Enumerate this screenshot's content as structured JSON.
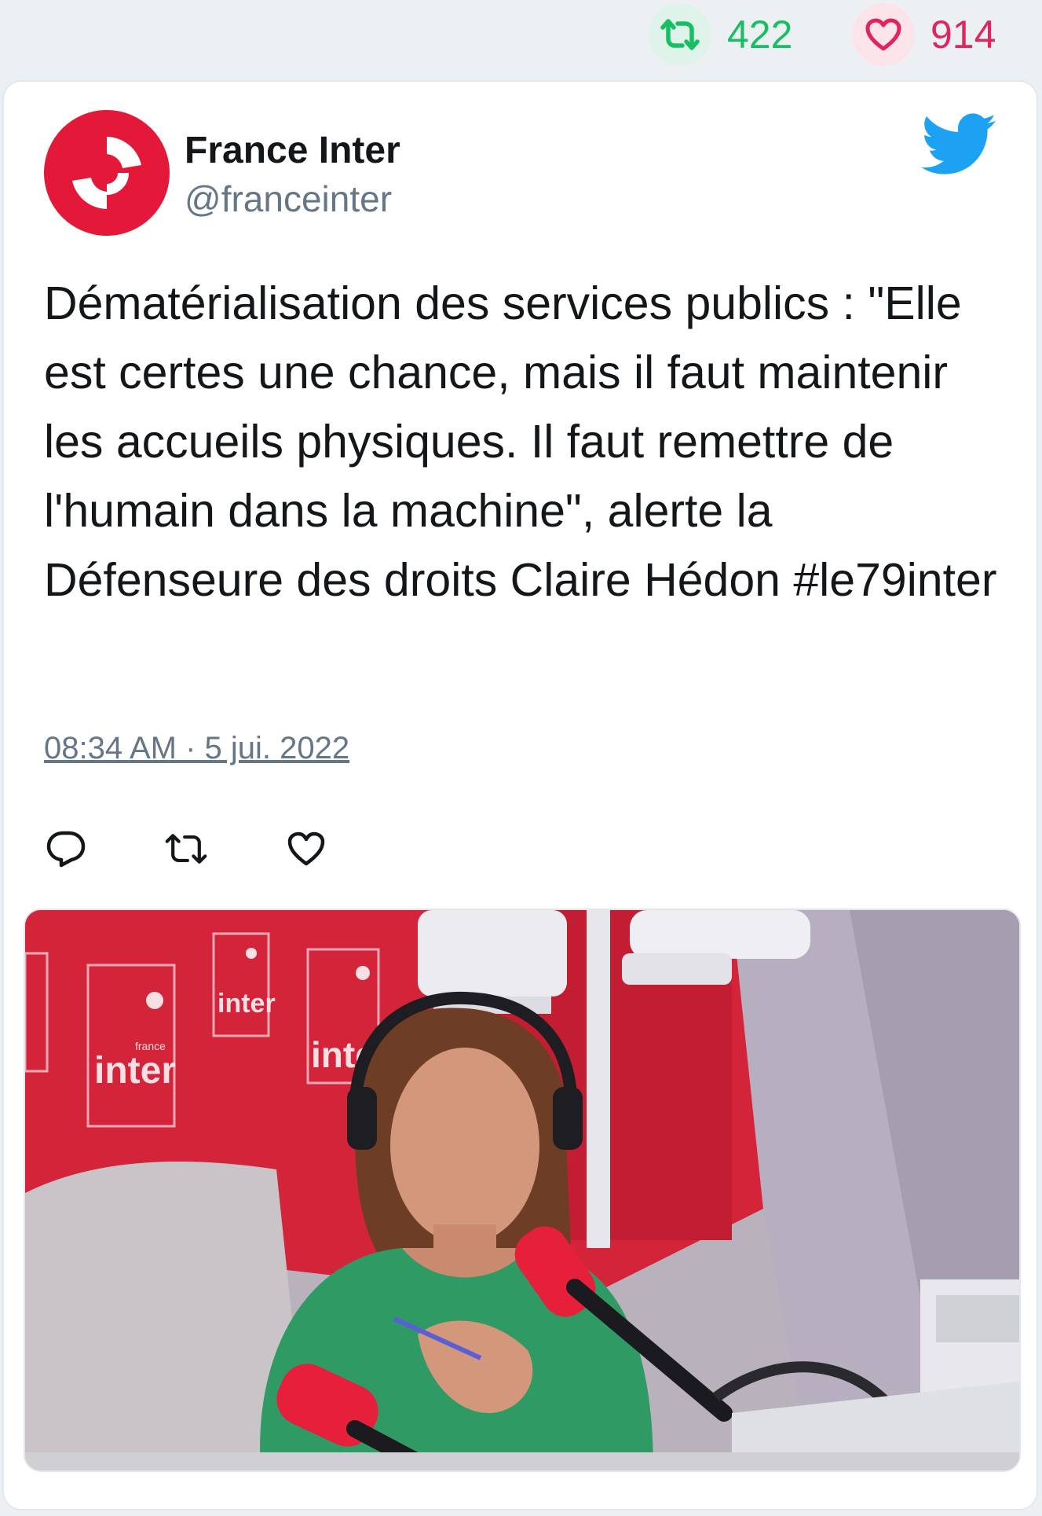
{
  "stats": {
    "retweet_count": "422",
    "like_count": "914"
  },
  "tweet": {
    "author_name": "France Inter",
    "author_handle": "@franceinter",
    "text": "Dématérialisation des services publics : \"Elle est certes une chance, mais il faut maintenir les accueils physiques. Il faut remettre de l'humain dans la machine\", alerte la Défenseure des droits Claire Hédon #le79inter",
    "timestamp": "08:34 AM · 5 jui. 2022"
  },
  "media": {
    "studio_brand_label": "inter",
    "studio_brand_small": "france"
  },
  "icons": {
    "retweet": "retweet-icon",
    "like": "heart-icon",
    "reply": "reply-icon",
    "twitter": "twitter-bird-icon"
  },
  "colors": {
    "retweet_green": "#17bf63",
    "like_red": "#e0245e",
    "brand_red": "#e4193a",
    "twitter_blue": "#1da1f2",
    "muted_text": "#657786"
  }
}
